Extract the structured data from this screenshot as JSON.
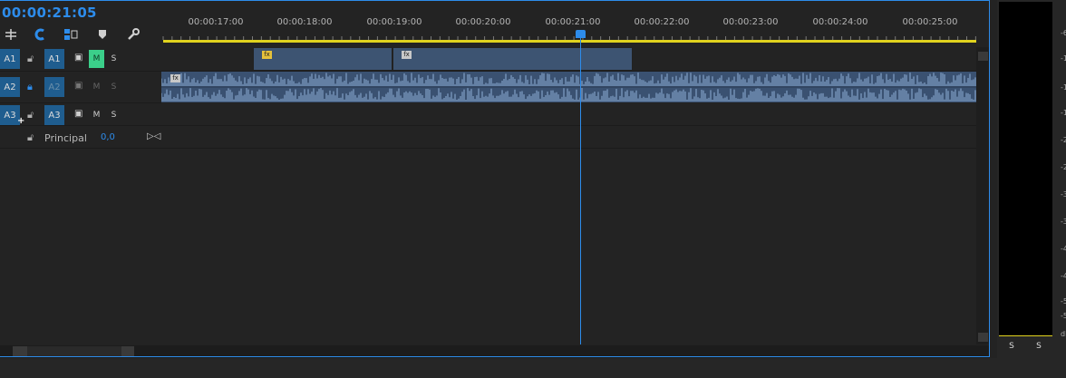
{
  "timecode": "00:00:21:05",
  "ruler": {
    "ticks": [
      "00:00:17:00",
      "00:00:18:00",
      "00:00:19:00",
      "00:00:20:00",
      "00:00:21:00",
      "00:00:22:00",
      "00:00:23:00",
      "00:00:24:00",
      "00:00:25:00"
    ]
  },
  "tracks": [
    {
      "source": "A1",
      "target": "A1",
      "m": "M",
      "s": "S"
    },
    {
      "source": "A2",
      "target": "A2",
      "m": "M",
      "s": "S"
    },
    {
      "source": "A3",
      "target": "A3",
      "m": "M",
      "s": "S"
    }
  ],
  "master": {
    "label": "Principal",
    "value": "0,0"
  },
  "clips": {
    "fx": "fx"
  },
  "meter": {
    "scale": [
      "-6",
      "-1",
      "-1",
      "-1",
      "-2",
      "-2",
      "-3",
      "-3",
      "-4",
      "-4",
      "-5",
      "-5",
      "dB"
    ],
    "solo": [
      "S",
      "S"
    ]
  },
  "colors": {
    "accent": "#2d8ceb",
    "mute_on": "#3bcf8a",
    "clip": "#3d5472",
    "playhead": "#2d8ceb",
    "work_area": "#e0d21e"
  }
}
